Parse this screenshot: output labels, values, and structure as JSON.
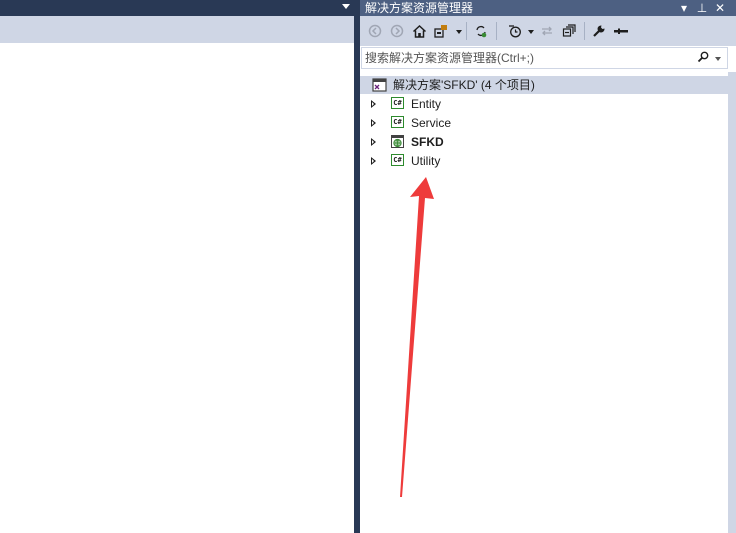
{
  "solution_explorer": {
    "title": "解决方案资源管理器",
    "title_buttons": [
      "▾",
      "⊥",
      "✕"
    ],
    "toolbar_icons": [
      "back-icon",
      "forward-icon",
      "home-icon",
      "switch-views-icon",
      "sync-icon",
      "pending-changes-filter-icon",
      "collapse-all-icon",
      "properties-icon",
      "preview-icon"
    ],
    "search": {
      "placeholder": "搜索解决方案资源管理器(Ctrl+;)"
    },
    "tree": {
      "root_label": "解决方案'SFKD' (4 个项目)",
      "projects": [
        {
          "label": "Entity",
          "icon": "csharp-project-icon",
          "bold": false
        },
        {
          "label": "Service",
          "icon": "csharp-project-icon",
          "bold": false
        },
        {
          "label": "SFKD",
          "icon": "web-project-icon",
          "bold": true
        },
        {
          "label": "Utility",
          "icon": "csharp-project-icon",
          "bold": false
        }
      ],
      "cs_badge": "C#"
    }
  },
  "colors": {
    "title_bar": "#4d6082",
    "dark_bg": "#293955",
    "toolbar": "#cfd6e5",
    "arrow": "#ee3b3b",
    "project_icon_border": "#2d8a2d"
  }
}
